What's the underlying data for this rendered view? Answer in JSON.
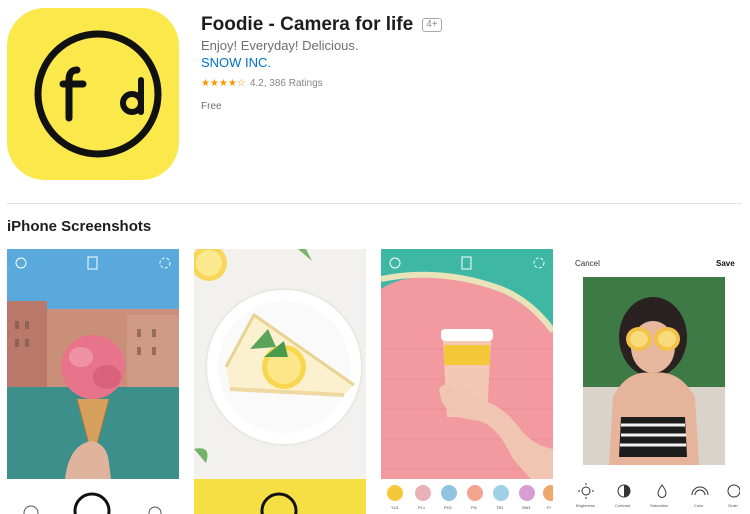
{
  "app": {
    "title": "Foodie - Camera for life",
    "age_rating": "4+",
    "subtitle": "Enjoy! Everyday! Delicious.",
    "developer": "SNOW INC.",
    "stars": "★★★★☆",
    "rating_text": "4.2, 386 Ratings",
    "price": "Free"
  },
  "section": {
    "title": "iPhone Screenshots"
  },
  "screenshot4": {
    "cancel_label": "Cancel",
    "save_label": "Save",
    "tools": [
      "Brightness",
      "Contrast",
      "Saturation",
      "Color",
      "Grain"
    ]
  },
  "screenshot3": {
    "filters": [
      "YU1",
      "PL1",
      "PO1",
      "PI1",
      "TR1",
      "SW1",
      "FI"
    ]
  },
  "colors": {
    "accent_yellow": "#fbe84a",
    "link_blue": "#0070c9",
    "star_orange": "#ff9500"
  },
  "icons": [
    "foodie-logo",
    "flip-camera-icon",
    "aspect-ratio-icon",
    "timer-icon",
    "shutter-button"
  ]
}
